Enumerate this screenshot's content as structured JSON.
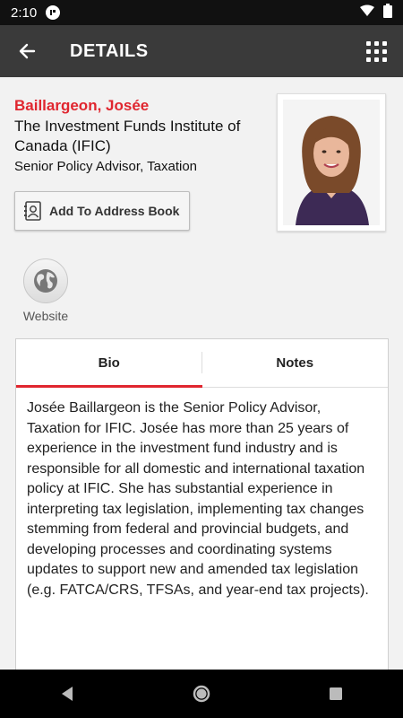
{
  "status": {
    "time": "2:10"
  },
  "app_bar": {
    "title": "DETAILS"
  },
  "contact": {
    "name": "Baillargeon, Josée",
    "organization": "The Investment Funds Institute of Canada (IFIC)",
    "role": "Senior Policy Advisor, Taxation"
  },
  "actions": {
    "add_address_book": "Add To Address Book",
    "website_label": "Website"
  },
  "tabs": [
    {
      "label": "Bio",
      "active": true
    },
    {
      "label": "Notes",
      "active": false
    }
  ],
  "bio": "Josée Baillargeon is the Senior Policy Advisor, Taxation for IFIC. Josée has more than 25 years of experience in the investment fund industry and is responsible for all domestic and international taxation policy at IFIC. She has substantial experience in interpreting tax legislation, implementing tax changes stemming from federal and provincial budgets, and developing processes and coordinating systems updates to support new and amended tax legislation (e.g. FATCA/CRS, TFSAs, and year-end tax projects).",
  "colors": {
    "accent": "#e0262f",
    "app_bar": "#3a3a3a",
    "status_bar": "#111111"
  },
  "icons": [
    "back-arrow-icon",
    "grid-menu-icon",
    "contact-card-icon",
    "globe-icon",
    "wifi-icon",
    "battery-icon",
    "back-triangle-icon",
    "home-circle-icon",
    "recents-square-icon"
  ]
}
